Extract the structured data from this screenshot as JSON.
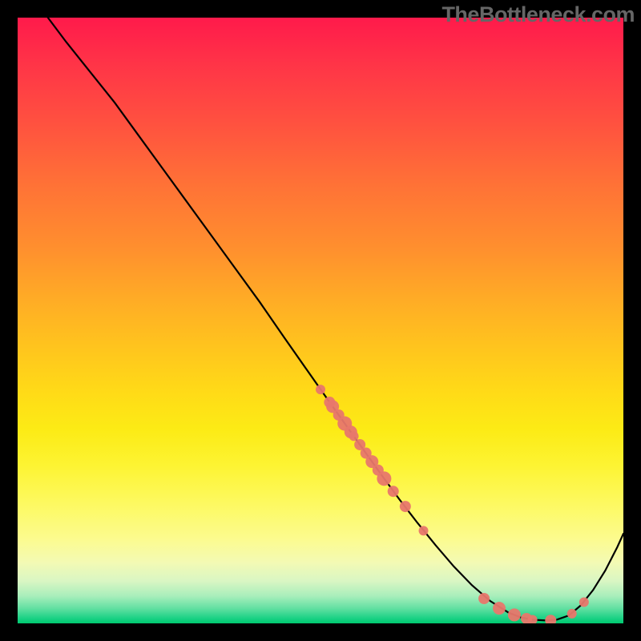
{
  "watermark": "TheBottleneck.com",
  "chart_data": {
    "type": "line",
    "title": "",
    "xlabel": "",
    "ylabel": "",
    "xlim": [
      0,
      100
    ],
    "ylim": [
      0,
      100
    ],
    "grid": false,
    "legend": false,
    "series": [
      {
        "name": "curve",
        "color": "#000000",
        "x": [
          5,
          8,
          12,
          16,
          20,
          24,
          28,
          32,
          36,
          40,
          44,
          48,
          52,
          54,
          56,
          58,
          60,
          63,
          66,
          69,
          72,
          75,
          78,
          81,
          83,
          85,
          87,
          89,
          91,
          93,
          95,
          97,
          99,
          100
        ],
        "y": [
          100,
          96,
          91,
          86,
          80.5,
          75,
          69.5,
          64,
          58.5,
          53,
          47.2,
          41.5,
          35.8,
          33,
          30.2,
          27.4,
          24.6,
          20.5,
          16.6,
          12.9,
          9.4,
          6.3,
          3.7,
          1.8,
          1.0,
          0.6,
          0.5,
          0.6,
          1.3,
          3.0,
          5.5,
          8.7,
          12.6,
          14.8
        ]
      }
    ],
    "points": [
      {
        "name": "scatter-on-curve",
        "color": "#e8776b",
        "x": [
          50.0,
          51.5,
          52.0,
          53.0,
          54.0,
          55.0,
          55.5,
          56.5,
          57.5,
          58.5,
          59.5,
          60.5,
          62.0,
          64.0,
          67.0,
          77.0,
          79.5,
          82.0,
          84.0,
          85.0,
          88.0,
          91.5,
          93.5
        ],
        "y": [
          38.6,
          36.5,
          35.8,
          34.4,
          33.0,
          31.6,
          30.9,
          29.5,
          28.1,
          26.7,
          25.3,
          23.9,
          21.8,
          19.3,
          15.3,
          4.1,
          2.5,
          1.4,
          0.8,
          0.6,
          0.5,
          1.6,
          3.5
        ],
        "r": [
          6,
          7,
          8,
          7,
          9,
          8,
          6,
          7,
          7,
          8,
          7,
          9,
          7,
          7,
          6,
          7,
          8,
          8,
          7,
          6,
          7,
          6,
          6
        ]
      }
    ],
    "background_gradient": {
      "direction": "vertical",
      "stops": [
        {
          "pos": 0.0,
          "color": "#ff1a4b"
        },
        {
          "pos": 0.4,
          "color": "#ff9a2a"
        },
        {
          "pos": 0.7,
          "color": "#fdee20"
        },
        {
          "pos": 0.9,
          "color": "#f3fab4"
        },
        {
          "pos": 1.0,
          "color": "#00c96f"
        }
      ]
    }
  }
}
